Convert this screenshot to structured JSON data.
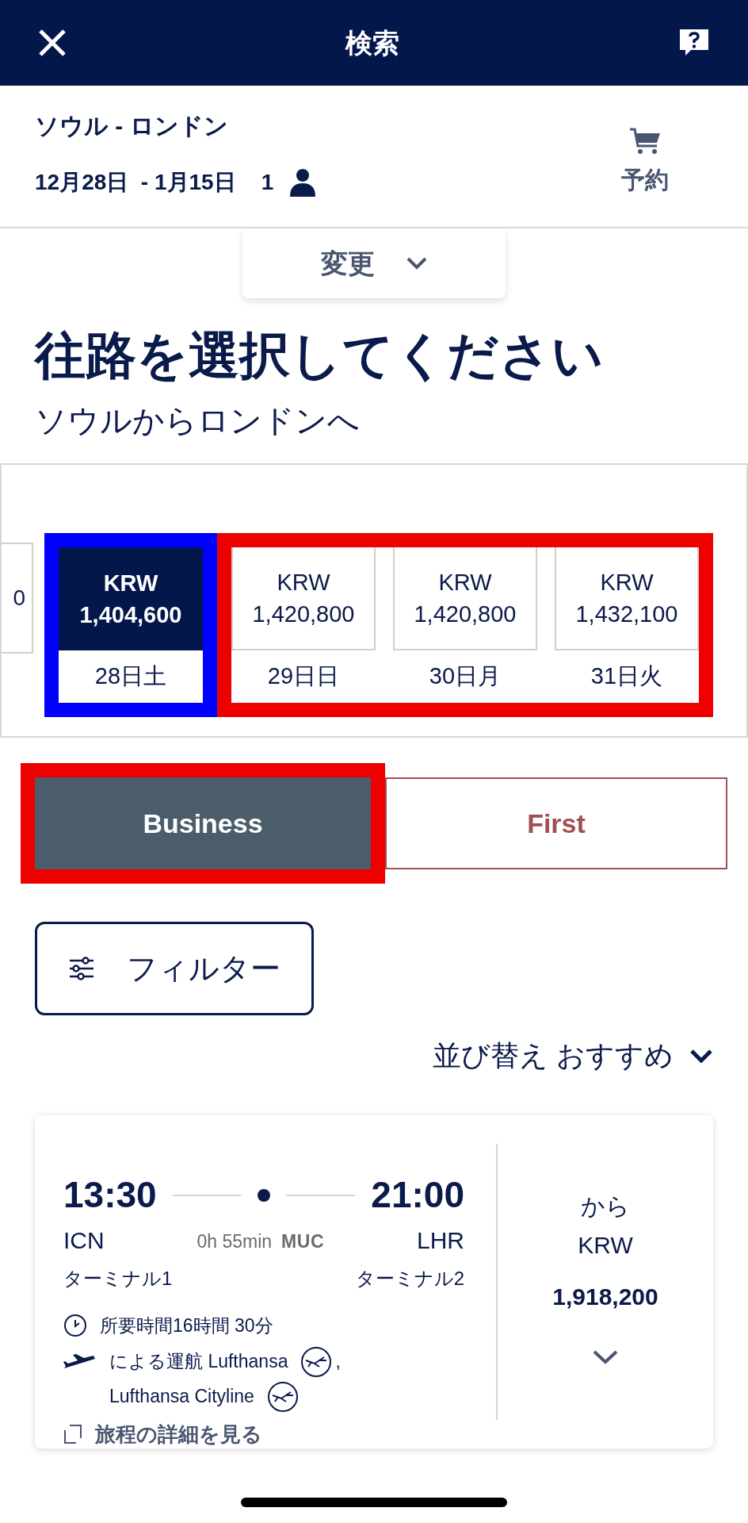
{
  "header": {
    "title": "検索"
  },
  "summary": {
    "route": "ソウル - ロンドン",
    "dates": "12月28日  - 1月15日",
    "passengers": "1",
    "cart_label": "予約"
  },
  "change_button": {
    "label": "変更"
  },
  "heading": "往路を選択してください",
  "subheading": "ソウルからロンドンへ",
  "date_strip": {
    "partial_cell": {
      "price_tail": "0"
    },
    "groups": [
      {
        "color": "#0000ff",
        "cells": [
          {
            "currency": "KRW",
            "price": "1,404,600",
            "date": "28日土",
            "selected": true
          }
        ]
      },
      {
        "color": "#ee0000",
        "cells": [
          {
            "currency": "KRW",
            "price": "1,420,800",
            "date": "29日日",
            "selected": false
          },
          {
            "currency": "KRW",
            "price": "1,420,800",
            "date": "30日月",
            "selected": false
          },
          {
            "currency": "KRW",
            "price": "1,432,100",
            "date": "31日火",
            "selected": false
          }
        ]
      }
    ]
  },
  "cabin_tabs": [
    {
      "label": "Business",
      "selected": true,
      "color": "#ee0000"
    },
    {
      "label": "First",
      "selected": false
    }
  ],
  "filter_button": {
    "label": "フィルター"
  },
  "sort": {
    "label": "並び替え おすすめ"
  },
  "flight": {
    "depart_time": "13:30",
    "depart_airport": "ICN",
    "depart_terminal": "ターミナル1",
    "layover_duration": "0h 55min",
    "layover_airport": "MUC",
    "arrive_time": "21:00",
    "arrive_airport": "LHR",
    "arrive_terminal": "ターミナル2",
    "duration": "所要時間16時間 30分",
    "operated_by": "による運航 Lufthansa",
    "operated_by_separator": ",",
    "operated_by_2": "Lufthansa Cityline",
    "details_link": "旅程の詳細を見る",
    "price_prefix": "から",
    "price_currency": "KRW",
    "price": "1,918,200"
  }
}
